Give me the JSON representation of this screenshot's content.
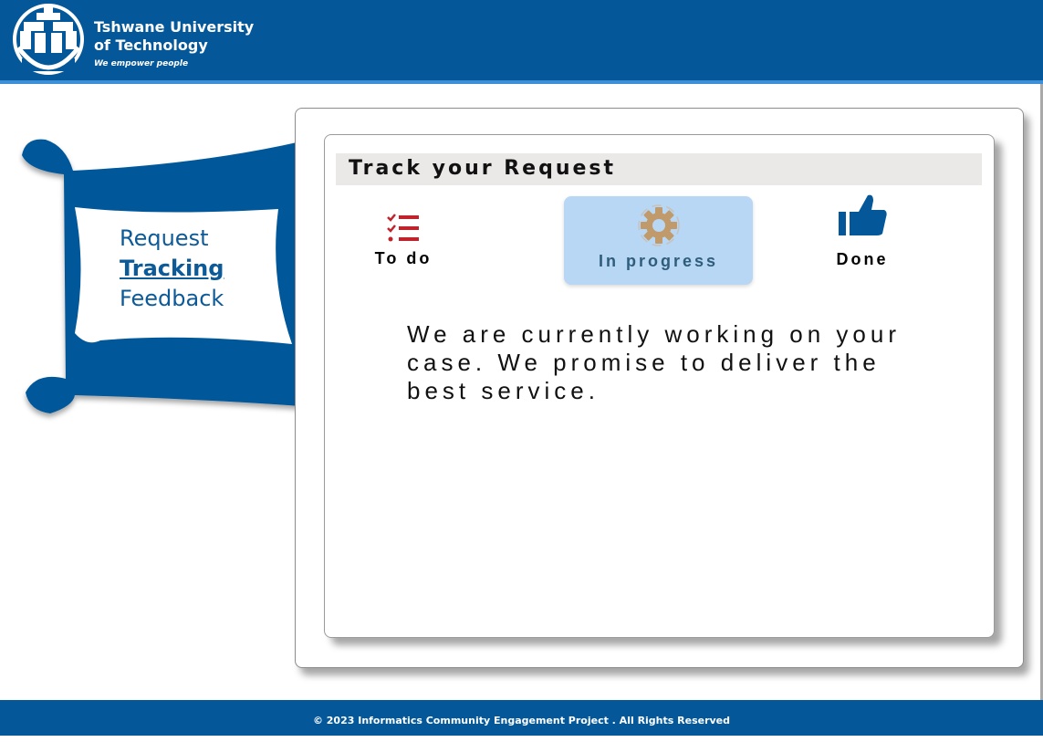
{
  "header": {
    "university_line1": "Tshwane University",
    "university_line2": "of Technology",
    "tagline": "We empower people"
  },
  "nav": {
    "items": [
      {
        "label": "Request",
        "active": false
      },
      {
        "label": "Tracking",
        "active": true
      },
      {
        "label": "Feedback",
        "active": false
      }
    ]
  },
  "tracker": {
    "title": "Track your Request",
    "statuses": [
      {
        "label": "To do",
        "icon": "checklist-icon",
        "selected": false
      },
      {
        "label": "In progress",
        "icon": "gear-icon",
        "selected": true
      },
      {
        "label": "Done",
        "icon": "thumbs-up-icon",
        "selected": false
      }
    ],
    "message": "We are currently working on your case. We promise to deliver the best service."
  },
  "footer": {
    "text": "© 2023 Informatics Community Engagement Project . All Rights Reserved"
  },
  "colors": {
    "brand_blue": "#04589a",
    "accent_blue": "#3d8fd8",
    "selected_bg": "#b7d7f5",
    "todo_red": "#c0232b",
    "gear_tan": "#c19a6b"
  }
}
